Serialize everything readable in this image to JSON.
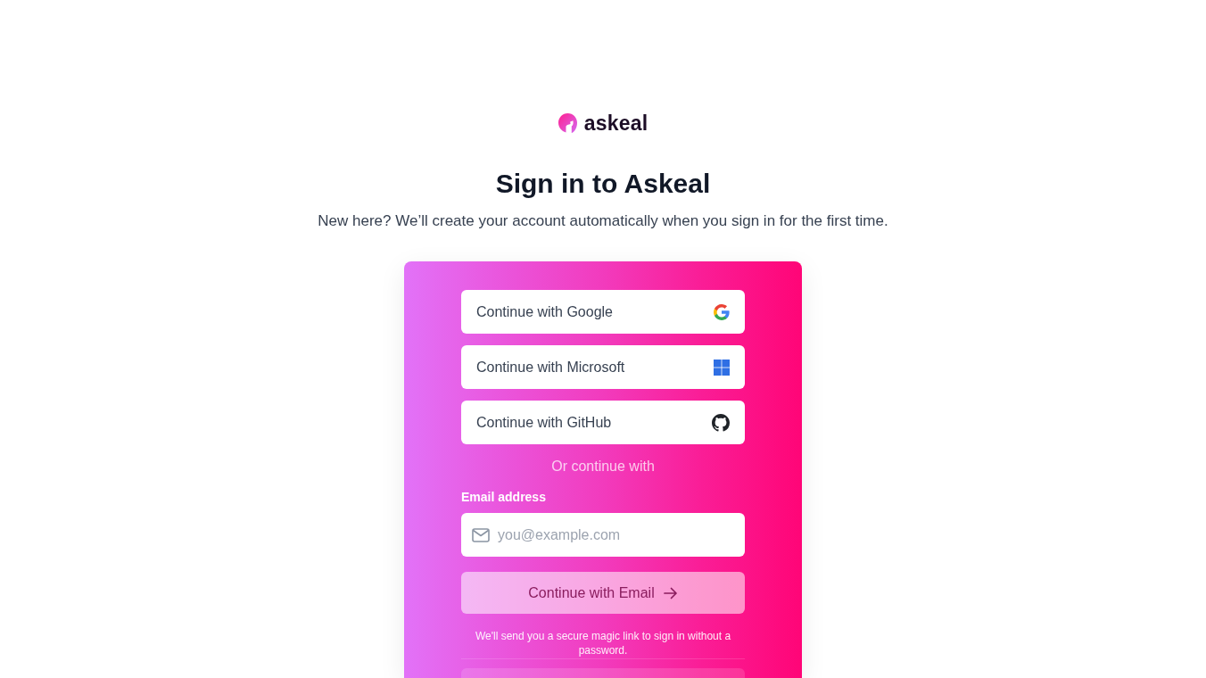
{
  "brand": {
    "name": "askeal"
  },
  "heading": {
    "title": "Sign in to Askeal",
    "subtitle": "New here? We’ll create your account automatically when you sign in for the first time."
  },
  "card": {
    "providers": [
      {
        "label": "Continue with Google",
        "kind": "google"
      },
      {
        "label": "Continue with Microsoft",
        "kind": "microsoft"
      },
      {
        "label": "Continue with GitHub",
        "kind": "github"
      }
    ],
    "divider_text": "Or continue with",
    "email": {
      "label": "Email address",
      "placeholder": "you@example.com"
    },
    "submit_button": {
      "label": "Continue with Email"
    },
    "note": "We'll send you a secure magic link to sign in without a password."
  }
}
